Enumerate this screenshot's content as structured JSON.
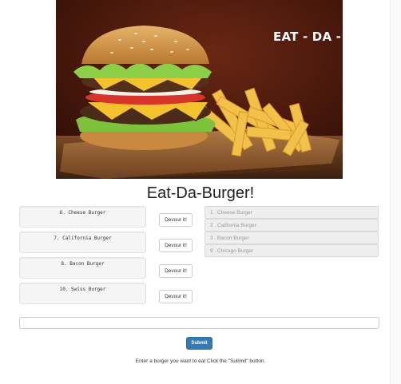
{
  "hero": {
    "title": "EAT - DA - BURGER"
  },
  "page_title": "Eat-Da-Burger!",
  "undevoured": [
    {
      "label": "6. Cheese Burger",
      "button": "Devour it!"
    },
    {
      "label": "7. California Burger",
      "button": "Devour it!"
    },
    {
      "label": "8. Bacon Burger",
      "button": "Devour it!"
    },
    {
      "label": "10. Swiss Burger",
      "button": "Devour it!"
    }
  ],
  "devoured": [
    {
      "label": "1 . Cheese Burger"
    },
    {
      "label": "2 . California Burger"
    },
    {
      "label": "3 . Bacon Burger"
    },
    {
      "label": "9 . Chicago Burger"
    }
  ],
  "form": {
    "input_value": "",
    "submit_label": "Submit",
    "instructions": "Enter a burger you want to eat Click the \"Submit\" button."
  },
  "colors": {
    "primary": "#337ab7",
    "well": "#f5f5f5",
    "devoured_bg": "#eeeeee"
  }
}
